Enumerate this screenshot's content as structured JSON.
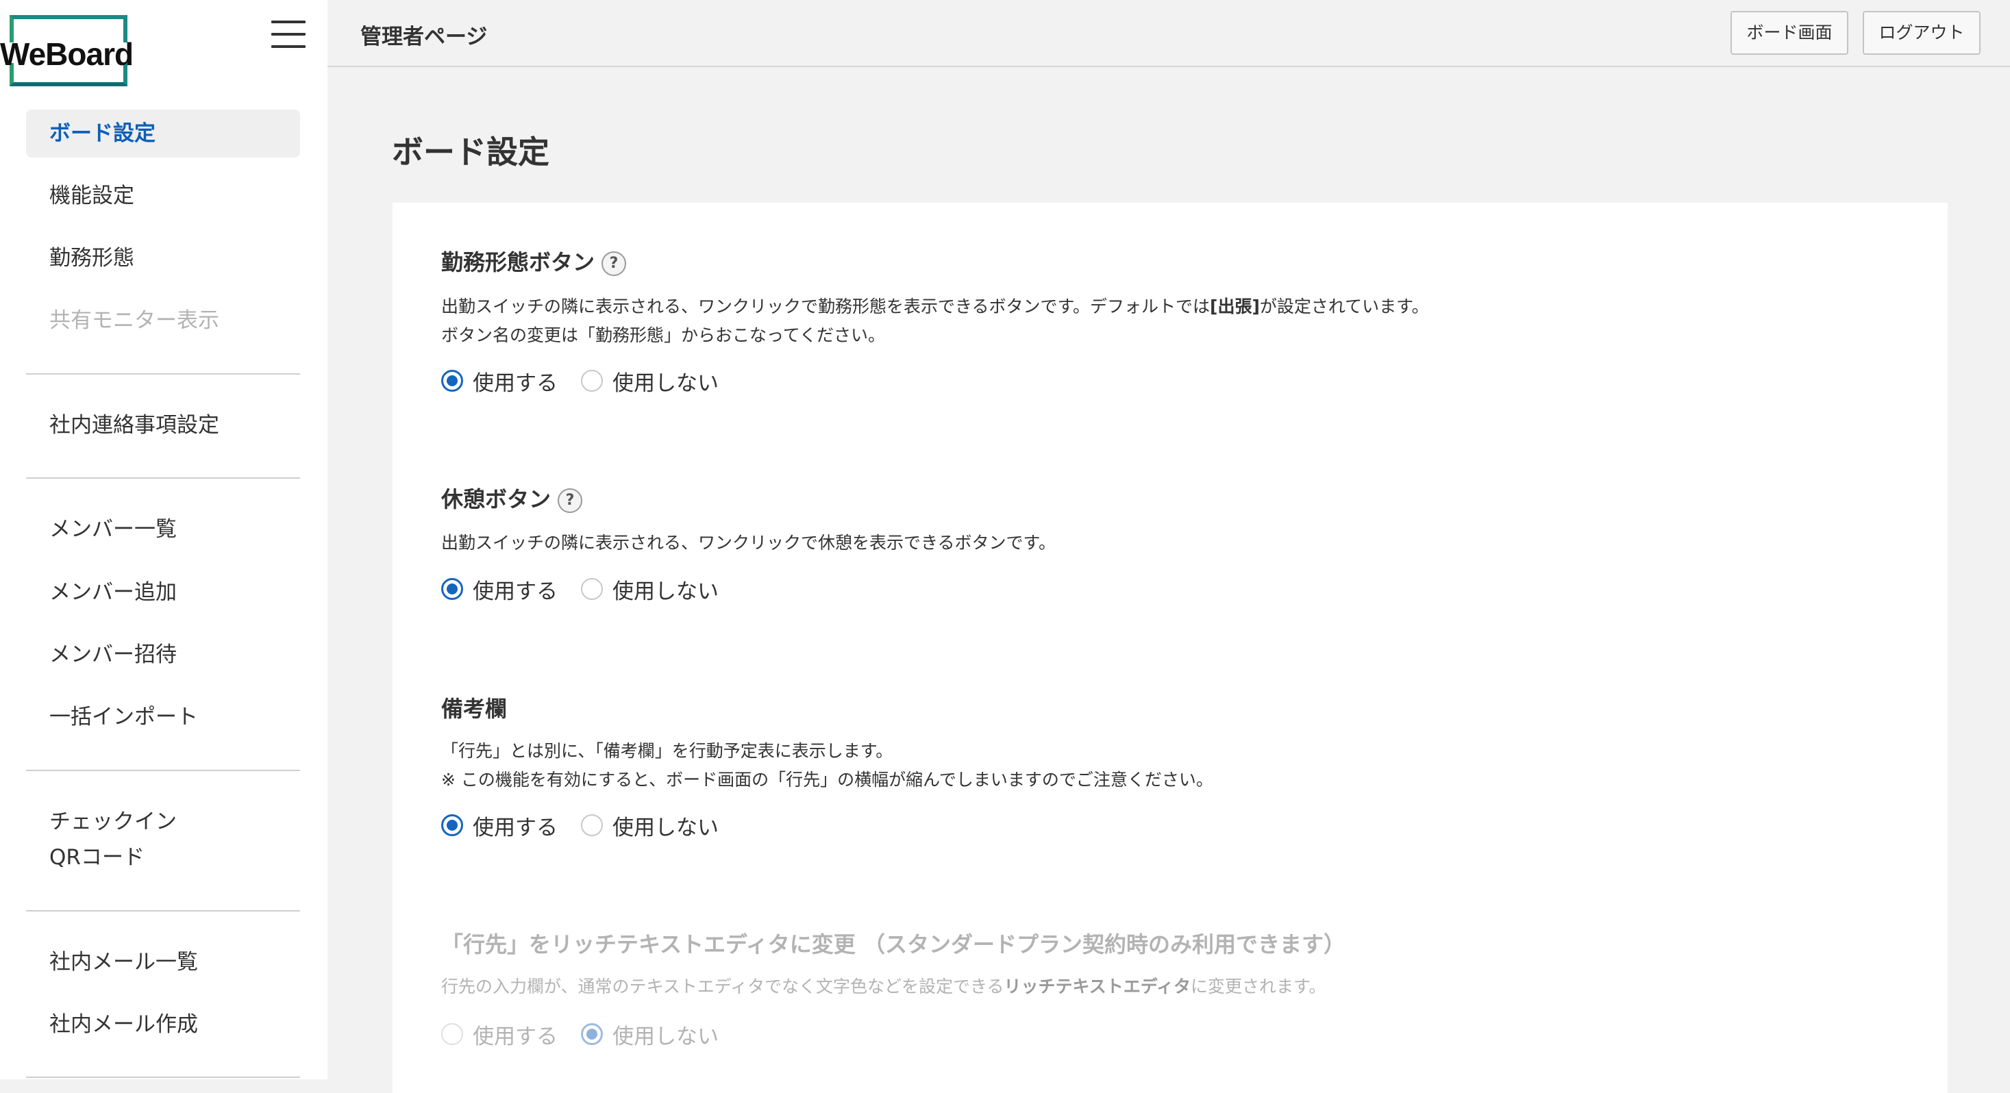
{
  "logo": {
    "text": "WeBoard"
  },
  "header": {
    "title": "管理者ページ",
    "board_button": "ボード画面",
    "logout_button": "ログアウト"
  },
  "sidebar": {
    "items": [
      {
        "label": "ボード設定"
      },
      {
        "label": "機能設定"
      },
      {
        "label": "勤務形態"
      },
      {
        "label": "共有モニター表示"
      },
      {
        "label": "社内連絡事項設定"
      },
      {
        "label": "メンバー一覧"
      },
      {
        "label": "メンバー追加"
      },
      {
        "label": "メンバー招待"
      },
      {
        "label": "一括インポート"
      },
      {
        "label_line1": "チェックイン",
        "label_line2": "QRコード"
      },
      {
        "label": "社内メール一覧"
      },
      {
        "label": "社内メール作成"
      }
    ]
  },
  "main": {
    "title": "ボード設定",
    "sections": [
      {
        "title": "勤務形態ボタン",
        "help": "?",
        "desc_line1_pre": "出勤スイッチの隣に表示される、ワンクリックで勤務形態を表示できるボタンです。デフォルトでは",
        "desc_line1_bold": "[出張]",
        "desc_line1_post": "が設定されています。",
        "desc_line2": "ボタン名の変更は「勤務形態」からおこなってください。",
        "option_use": "使用する",
        "option_not_use": "使用しない",
        "selected": "use"
      },
      {
        "title": "休憩ボタン",
        "help": "?",
        "desc_line1": "出勤スイッチの隣に表示される、ワンクリックで休憩を表示できるボタンです。",
        "option_use": "使用する",
        "option_not_use": "使用しない",
        "selected": "use"
      },
      {
        "title": "備考欄",
        "desc_line1": "「行先」とは別に、「備考欄」を行動予定表に表示します。",
        "desc_line2": "※ この機能を有効にすると、ボード画面の「行先」の横幅が縮んでしまいますのでご注意ください。",
        "option_use": "使用する",
        "option_not_use": "使用しない",
        "selected": "use"
      },
      {
        "title": "「行先」をリッチテキストエディタに変更 （スタンダードプラン契約時のみ利用できます）",
        "desc_line1_pre": "行先の入力欄が、通常のテキストエディタでなく文字色などを設定できる",
        "desc_line1_bold": "リッチテキストエディタ",
        "desc_line1_post": "に変更されます。",
        "option_use": "使用する",
        "option_not_use": "使用しない",
        "selected": "not_use",
        "disabled": true
      }
    ]
  },
  "colors": {
    "accent": "#1565c0",
    "active_nav_text": "#0d5fb8",
    "background": "#f2f2f2"
  }
}
